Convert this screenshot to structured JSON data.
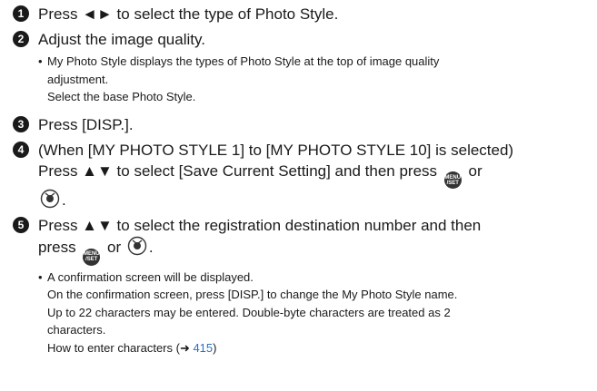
{
  "steps": [
    {
      "number": "1",
      "lines": [
        "Press ◄► to select the type of Photo Style."
      ]
    },
    {
      "number": "2",
      "lines": [
        "Adjust the image quality."
      ],
      "bullets": [
        {
          "marker": "•",
          "lines": [
            "My Photo Style displays the types of Photo Style at the top of image quality",
            "adjustment.",
            "Select the base Photo Style."
          ]
        }
      ]
    },
    {
      "number": "3",
      "lines": [
        "Press [DISP.]."
      ]
    },
    {
      "number": "4",
      "line1": "(When [MY PHOTO STYLE 1] to [MY PHOTO STYLE 10] is selected)",
      "line2_prefix": "Press ▲▼ to select [Save Current Setting] and then press",
      "or_text": "or",
      "period": "."
    },
    {
      "number": "5",
      "line1": "Press ▲▼ to select the registration destination number and then",
      "press_text": "press",
      "or_text": "or",
      "period": ".",
      "bullet": {
        "marker": "•",
        "lines": [
          "A confirmation screen will be displayed.",
          "On the confirmation screen, press [DISP.] to change the My Photo Style name.",
          "Up to 22 characters may be entered. Double-byte characters are treated as 2",
          "characters."
        ],
        "link_prefix": "How to enter characters (➜ ",
        "link_page": "415",
        "link_suffix": ")"
      }
    }
  ],
  "icons": {
    "menu_set": "menu-set-button-icon",
    "dial": "control-dial-press-icon"
  },
  "colors": {
    "text": "#1a1a1a",
    "link": "#2a6fc9",
    "badge": "#1a1a1a"
  }
}
